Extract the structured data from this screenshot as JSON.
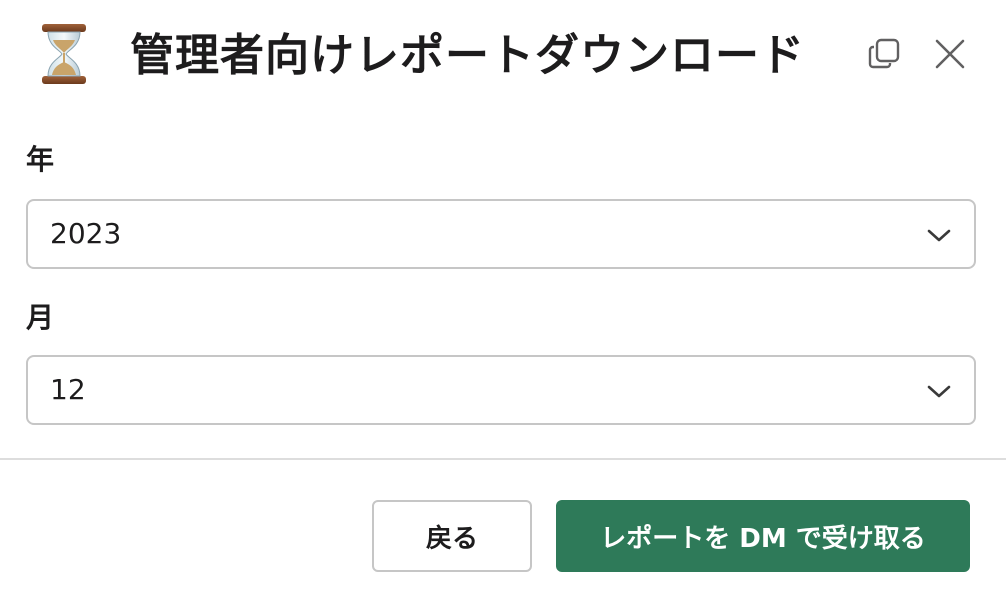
{
  "header": {
    "title": "管理者向けレポートダウンロード",
    "app_icon": "hourglass-icon",
    "copy_icon": "copy-icon",
    "close_icon": "close-icon"
  },
  "form": {
    "year": {
      "label": "年",
      "value": "2023"
    },
    "month": {
      "label": "月",
      "value": "12"
    }
  },
  "footer": {
    "back_label": "戻る",
    "submit_label": "レポートを DM で受け取る"
  },
  "colors": {
    "primary": "#2e7a59",
    "border": "#c6c6c6",
    "text": "#1d1c1d"
  }
}
